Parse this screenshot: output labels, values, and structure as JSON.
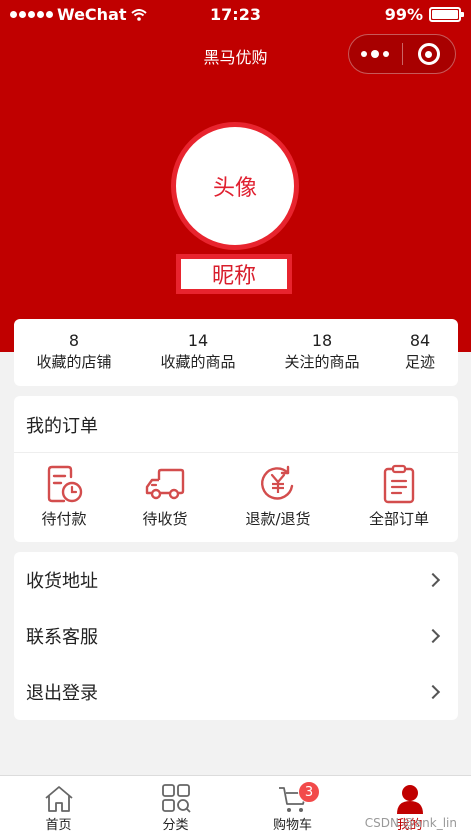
{
  "status_bar": {
    "carrier": "WeChat",
    "time": "17:23",
    "battery": "99%",
    "battery_level": 0.99
  },
  "nav": {
    "title": "黑马优购"
  },
  "profile": {
    "avatar_label": "头像",
    "nickname": "昵称"
  },
  "stats": [
    {
      "value": "8",
      "label": "收藏的店铺"
    },
    {
      "value": "14",
      "label": "收藏的商品"
    },
    {
      "value": "18",
      "label": "关注的商品"
    },
    {
      "value": "84",
      "label": "足迹"
    }
  ],
  "orders": {
    "title": "我的订单",
    "items": [
      {
        "label": "待付款",
        "icon": "pending-payment-icon"
      },
      {
        "label": "待收货",
        "icon": "delivery-truck-icon"
      },
      {
        "label": "退款/退货",
        "icon": "refund-icon"
      },
      {
        "label": "全部订单",
        "icon": "clipboard-icon"
      }
    ]
  },
  "menu": [
    {
      "label": "收货地址"
    },
    {
      "label": "联系客服"
    },
    {
      "label": "退出登录"
    }
  ],
  "tabbar": {
    "items": [
      {
        "label": "首页",
        "icon": "home-icon"
      },
      {
        "label": "分类",
        "icon": "category-icon"
      },
      {
        "label": "购物车",
        "icon": "cart-icon",
        "badge": "3"
      },
      {
        "label": "我的",
        "icon": "user-icon",
        "active": true
      }
    ]
  },
  "watermark": "CSDN @ank_lin",
  "colors": {
    "brand": "#c00000",
    "avatar_border": "#e8242e",
    "icon": "#d34d4d",
    "badge": "#f24a4a"
  }
}
